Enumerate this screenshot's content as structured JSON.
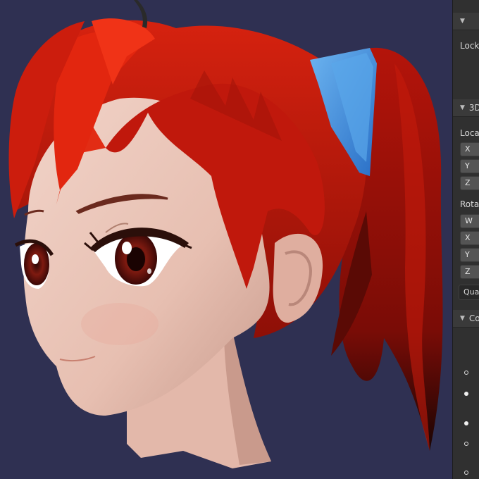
{
  "viewport": {
    "background": "#2f3052",
    "subject": "anime character head model",
    "hair_color": "#c81a0e",
    "hair_tie_color": "#3f8fdf",
    "skin_color": "#e9c4b6",
    "eye_color": "#7a1a10"
  },
  "panel": {
    "lock_label": "Lock",
    "section_3d": "3D",
    "location_label": "Loca",
    "location_fields": [
      "X",
      "Y",
      "Z"
    ],
    "rotation_label": "Rota",
    "rotation_fields": [
      "W",
      "X",
      "Y",
      "Z"
    ],
    "rotation_mode": "Qua",
    "section_co": "Co",
    "radio_states": [
      "hollow",
      "filled",
      "filled",
      "hollow",
      "hollow"
    ]
  }
}
